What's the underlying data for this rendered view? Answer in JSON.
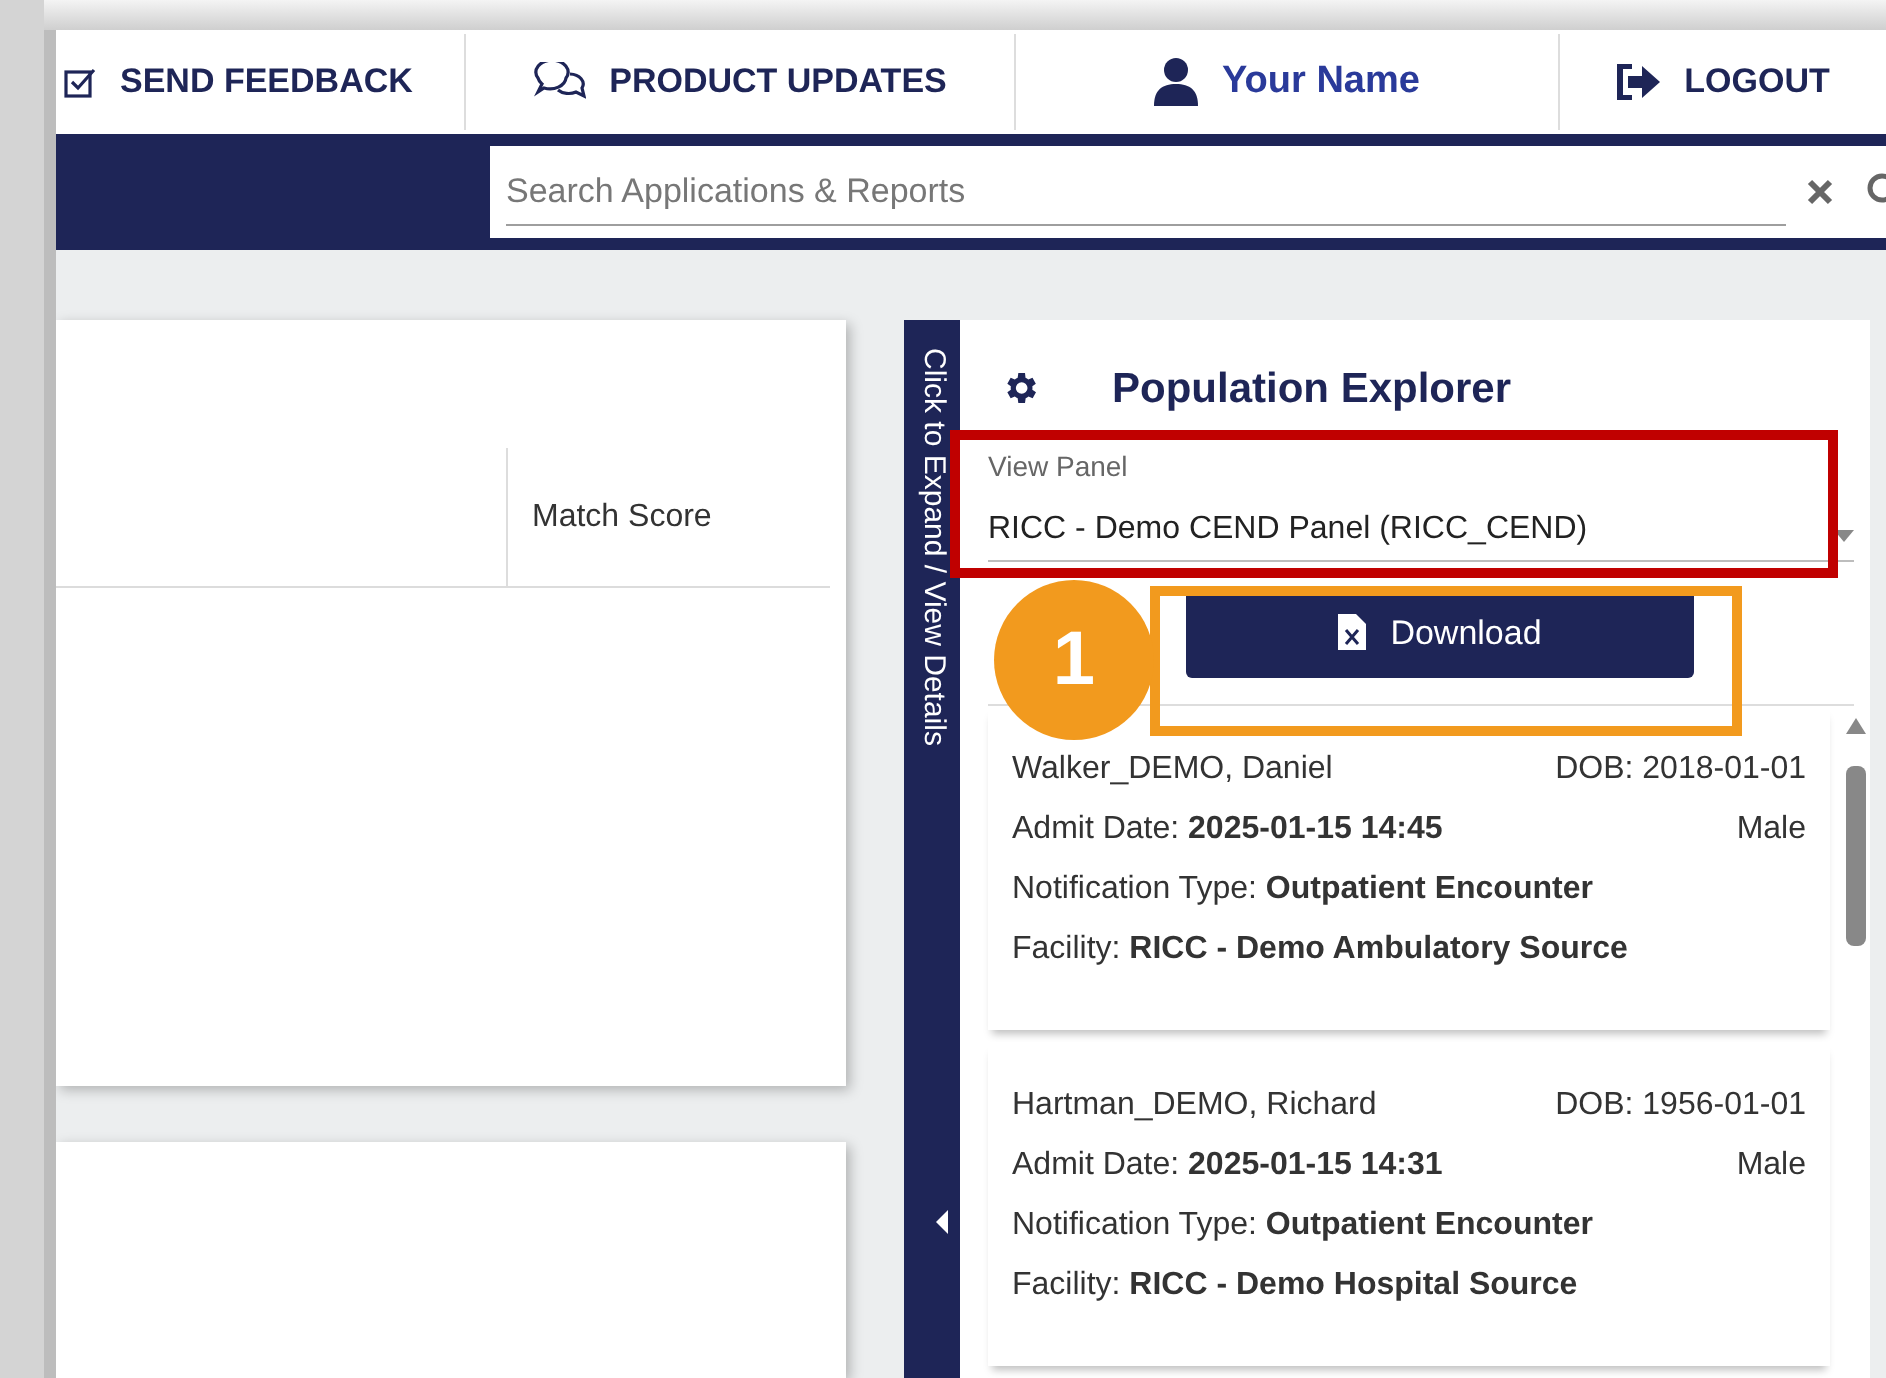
{
  "top_nav": {
    "items": [
      {
        "kind": "feedback",
        "label": "SEND FEEDBACK"
      },
      {
        "kind": "updates",
        "label": "PRODUCT UPDATES"
      },
      {
        "kind": "user",
        "label": "Your Name"
      },
      {
        "kind": "logout",
        "label": "LOGOUT"
      }
    ]
  },
  "search": {
    "placeholder": "Search Applications & Reports"
  },
  "results_card": {
    "columns": [
      "Match Score"
    ]
  },
  "side_tab": {
    "label": "Click to Expand / View Details"
  },
  "population_explorer": {
    "title": "Population Explorer",
    "view_panel": {
      "label": "View Panel",
      "value": "RICC - Demo CEND Panel (RICC_CEND)"
    },
    "download_button": "Download",
    "patients": [
      {
        "name": "Walker_DEMO, Daniel",
        "dob": "DOB: 2018-01-01",
        "admit": "Admit Date: **2025-01-15 14:45**",
        "sex": "Male",
        "notification": "Notification Type: **Outpatient Encounter**",
        "facility": "Facility: **RICC - Demo Ambulatory Source**"
      },
      {
        "name": "Hartman_DEMO, Richard",
        "dob": "DOB: 1956-01-01",
        "admit": "Admit Date: **2025-01-15 14:31**",
        "sex": "Male",
        "notification": "Notification Type: **Outpatient Encounter**",
        "facility": "Facility: **RICC - Demo Hospital Source**"
      }
    ]
  },
  "annotation": {
    "step": "1"
  }
}
